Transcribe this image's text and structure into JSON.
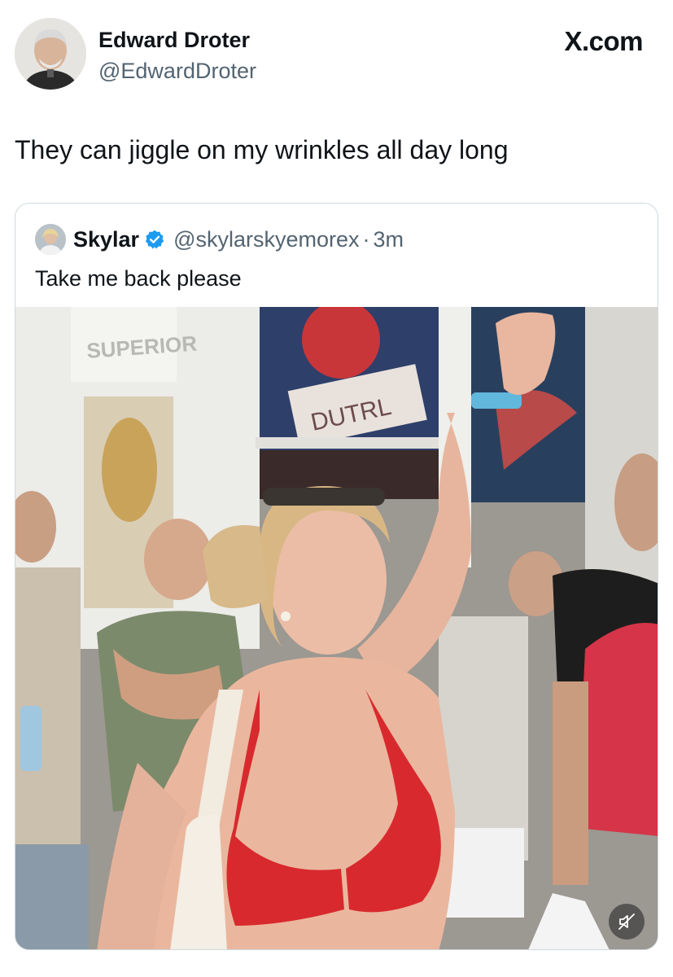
{
  "post": {
    "author_name": "Edward Droter",
    "author_handle": "@EdwardDroter",
    "brand": "X.com",
    "text": "They can jiggle on my wrinkles all day long"
  },
  "quoted_post": {
    "author_name": "Skylar",
    "author_handle": "@skylarskyemorex",
    "separator": "·",
    "time": "3m",
    "text": "Take me back please",
    "verified": true,
    "verified_color": "#1d9bf0",
    "media": {
      "sign_text_1": "SUPERIOR",
      "sign_text_2": "DUTRL",
      "mute_icon": "muted-speaker-icon"
    }
  }
}
